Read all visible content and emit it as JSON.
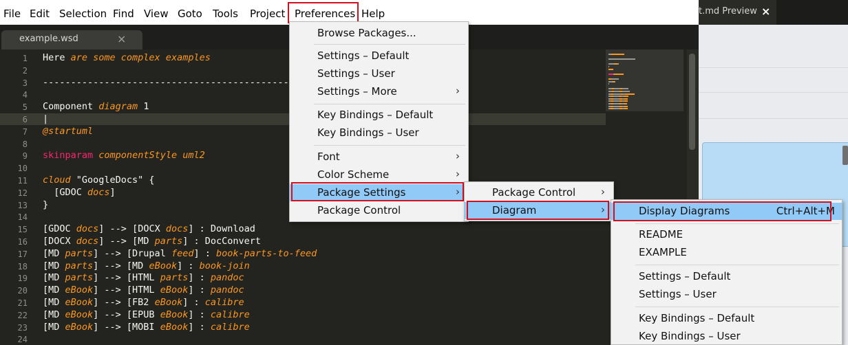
{
  "menubar": {
    "items": [
      "File",
      "Edit",
      "Selection",
      "Find",
      "View",
      "Goto",
      "Tools",
      "Project",
      "Preferences",
      "Help"
    ]
  },
  "editor_tab": {
    "label": "example.wsd",
    "close": "×"
  },
  "preview_tab": {
    "label": "t.md Preview",
    "close": "×"
  },
  "code_lines": [
    {
      "n": "1",
      "segs": [
        {
          "t": "Here ",
          "c": "p"
        },
        {
          "t": "are some complex examples",
          "c": "i"
        }
      ]
    },
    {
      "n": "2",
      "segs": []
    },
    {
      "n": "3",
      "segs": [
        {
          "t": "----------------------------------------------------",
          "c": "p"
        }
      ]
    },
    {
      "n": "4",
      "segs": []
    },
    {
      "n": "5",
      "segs": [
        {
          "t": "Component ",
          "c": "p"
        },
        {
          "t": "diagram",
          "c": "i"
        },
        {
          "t": " 1",
          "c": "p"
        }
      ]
    },
    {
      "n": "6",
      "segs": [
        {
          "t": "|",
          "c": "p"
        }
      ]
    },
    {
      "n": "7",
      "segs": [
        {
          "t": "@startuml",
          "c": "i"
        }
      ]
    },
    {
      "n": "8",
      "segs": []
    },
    {
      "n": "9",
      "segs": [
        {
          "t": "skinparam",
          "c": "k"
        },
        {
          "t": " ",
          "c": "p"
        },
        {
          "t": "componentStyle uml2",
          "c": "i"
        }
      ]
    },
    {
      "n": "10",
      "segs": []
    },
    {
      "n": "11",
      "segs": [
        {
          "t": "cloud",
          "c": "i"
        },
        {
          "t": " \"GoogleDocs\" {",
          "c": "p"
        }
      ]
    },
    {
      "n": "12",
      "segs": [
        {
          "t": "  [GDOC ",
          "c": "p"
        },
        {
          "t": "docs",
          "c": "i"
        },
        {
          "t": "]",
          "c": "p"
        }
      ]
    },
    {
      "n": "13",
      "segs": [
        {
          "t": "}",
          "c": "p"
        }
      ]
    },
    {
      "n": "14",
      "segs": []
    },
    {
      "n": "15",
      "segs": [
        {
          "t": "[GDOC ",
          "c": "p"
        },
        {
          "t": "docs",
          "c": "i"
        },
        {
          "t": "] --> [DOCX ",
          "c": "p"
        },
        {
          "t": "docs",
          "c": "i"
        },
        {
          "t": "] : Download",
          "c": "p"
        }
      ]
    },
    {
      "n": "16",
      "segs": [
        {
          "t": "[DOCX ",
          "c": "p"
        },
        {
          "t": "docs",
          "c": "i"
        },
        {
          "t": "] --> [MD ",
          "c": "p"
        },
        {
          "t": "parts",
          "c": "i"
        },
        {
          "t": "] : DocConvert",
          "c": "p"
        }
      ]
    },
    {
      "n": "17",
      "segs": [
        {
          "t": "[MD ",
          "c": "p"
        },
        {
          "t": "parts",
          "c": "i"
        },
        {
          "t": "] --> [Drupal ",
          "c": "p"
        },
        {
          "t": "feed",
          "c": "i"
        },
        {
          "t": "] : ",
          "c": "p"
        },
        {
          "t": "book-parts-to-feed",
          "c": "i"
        }
      ]
    },
    {
      "n": "18",
      "segs": [
        {
          "t": "[MD ",
          "c": "p"
        },
        {
          "t": "parts",
          "c": "i"
        },
        {
          "t": "] --> [MD ",
          "c": "p"
        },
        {
          "t": "eBook",
          "c": "i"
        },
        {
          "t": "] : ",
          "c": "p"
        },
        {
          "t": "book-join",
          "c": "i"
        }
      ]
    },
    {
      "n": "19",
      "segs": [
        {
          "t": "[MD ",
          "c": "p"
        },
        {
          "t": "parts",
          "c": "i"
        },
        {
          "t": "] --> [HTML ",
          "c": "p"
        },
        {
          "t": "parts",
          "c": "i"
        },
        {
          "t": "] : ",
          "c": "p"
        },
        {
          "t": "pandoc",
          "c": "i"
        }
      ]
    },
    {
      "n": "20",
      "segs": [
        {
          "t": "[MD ",
          "c": "p"
        },
        {
          "t": "eBook",
          "c": "i"
        },
        {
          "t": "] --> [HTML ",
          "c": "p"
        },
        {
          "t": "eBook",
          "c": "i"
        },
        {
          "t": "] : ",
          "c": "p"
        },
        {
          "t": "pandoc",
          "c": "i"
        }
      ]
    },
    {
      "n": "21",
      "segs": [
        {
          "t": "[MD ",
          "c": "p"
        },
        {
          "t": "eBook",
          "c": "i"
        },
        {
          "t": "] --> [FB2 ",
          "c": "p"
        },
        {
          "t": "eBook",
          "c": "i"
        },
        {
          "t": "] : ",
          "c": "p"
        },
        {
          "t": "calibre",
          "c": "i"
        }
      ]
    },
    {
      "n": "22",
      "segs": [
        {
          "t": "[MD ",
          "c": "p"
        },
        {
          "t": "eBook",
          "c": "i"
        },
        {
          "t": "] --> [EPUB ",
          "c": "p"
        },
        {
          "t": "eBook",
          "c": "i"
        },
        {
          "t": "] : ",
          "c": "p"
        },
        {
          "t": "calibre",
          "c": "i"
        }
      ]
    },
    {
      "n": "23",
      "segs": [
        {
          "t": "[MD ",
          "c": "p"
        },
        {
          "t": "eBook",
          "c": "i"
        },
        {
          "t": "] --> [MOBI ",
          "c": "p"
        },
        {
          "t": "eBook",
          "c": "i"
        },
        {
          "t": "] : ",
          "c": "p"
        },
        {
          "t": "calibre",
          "c": "i"
        }
      ]
    },
    {
      "n": "24",
      "segs": []
    }
  ],
  "preferences_menu": [
    {
      "label": "Browse Packages...",
      "submenu": false
    },
    {
      "label": "Settings – Default",
      "submenu": false
    },
    {
      "label": "Settings – User",
      "submenu": false
    },
    {
      "label": "Settings – More",
      "submenu": true
    },
    {
      "label": "Key Bindings – Default",
      "submenu": false
    },
    {
      "label": "Key Bindings – User",
      "submenu": false
    },
    {
      "label": "Font",
      "submenu": true
    },
    {
      "label": "Color Scheme",
      "submenu": true
    },
    {
      "label": "Package Settings",
      "submenu": true
    },
    {
      "label": "Package Control",
      "submenu": false
    }
  ],
  "package_settings_menu": [
    {
      "label": "Package Control",
      "submenu": true
    },
    {
      "label": "Diagram",
      "submenu": true
    }
  ],
  "diagram_menu": [
    {
      "label": "Display Diagrams",
      "shortcut": "Ctrl+Alt+M"
    },
    {
      "label": "README",
      "shortcut": ""
    },
    {
      "label": "EXAMPLE",
      "shortcut": ""
    },
    {
      "label": "Settings – Default",
      "shortcut": ""
    },
    {
      "label": "Settings – User",
      "shortcut": ""
    },
    {
      "label": "Key Bindings – Default",
      "shortcut": ""
    },
    {
      "label": "Key Bindings – User",
      "shortcut": ""
    }
  ],
  "submenu_arrow": "›",
  "colors": {
    "highlight_border": "#d0101e",
    "menu_active": "#91c9f7",
    "keyword": "#f92672",
    "italic": "#fd971f",
    "editor_bg": "#23241f"
  }
}
